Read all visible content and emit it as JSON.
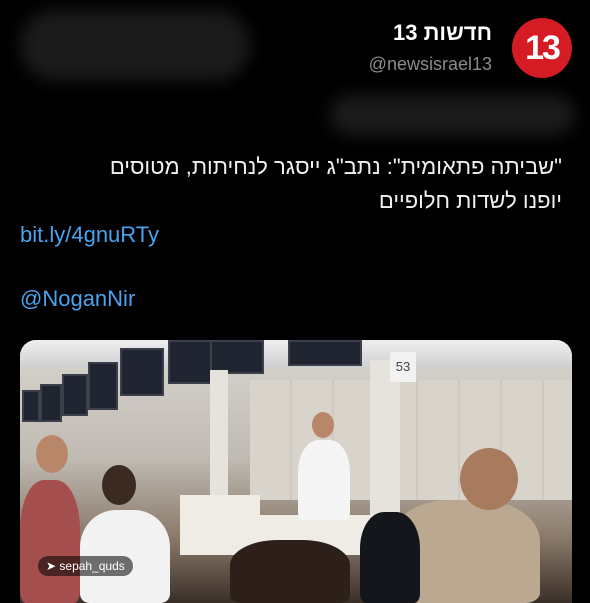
{
  "tweet": {
    "author": {
      "display_name": "חדשות 13",
      "handle": "@newsisrael13",
      "avatar_text": "13",
      "avatar_color": "#d51b24"
    },
    "text_line1": "\"שביתה פתאומית\": נתב\"ג ייסגר לנחיתות, מטוסים",
    "text_line2": "יופנו לשדות חלופיים",
    "link": "bit.ly/4gnuRTy",
    "mention": "@NoganNir",
    "media": {
      "gate_sign": "53",
      "watermark": "sepah_quds"
    }
  },
  "colors": {
    "background": "#000000",
    "link": "#4aa3ef",
    "muted": "#8b8b8b"
  }
}
